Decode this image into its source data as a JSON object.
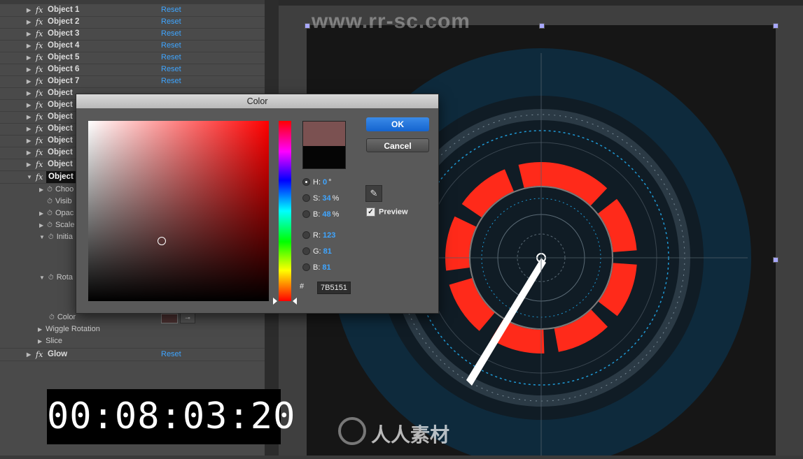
{
  "effects": {
    "reset_label": "Reset",
    "objects": [
      {
        "name": "Object 1"
      },
      {
        "name": "Object 2"
      },
      {
        "name": "Object 3"
      },
      {
        "name": "Object 4"
      },
      {
        "name": "Object 5"
      },
      {
        "name": "Object 6"
      },
      {
        "name": "Object 7"
      },
      {
        "name": "Object"
      },
      {
        "name": "Object"
      },
      {
        "name": "Object"
      },
      {
        "name": "Object"
      },
      {
        "name": "Object"
      },
      {
        "name": "Object"
      },
      {
        "name": "Object"
      },
      {
        "name": "Object"
      }
    ],
    "properties": [
      "Choo",
      "Visib",
      "Opac",
      "Scale",
      "Initia",
      "Rota"
    ],
    "color_label": "Color",
    "wiggle_label": "Wiggle Rotation",
    "slice_label": "Slice",
    "glow_label": "Glow"
  },
  "dialog": {
    "title": "Color",
    "ok": "OK",
    "cancel": "Cancel",
    "preview": "Preview",
    "preview_checked": true,
    "h_label": "H:",
    "h_value": "0",
    "h_unit": "°",
    "s_label": "S:",
    "s_value": "34",
    "s_unit": "%",
    "b_label": "B:",
    "b_value": "48",
    "b_unit": "%",
    "r_label": "R:",
    "r_value": "123",
    "g_label": "G:",
    "g_value": "81",
    "bl_label": "B:",
    "bl_value": "81",
    "hex_label": "#",
    "hex_value": "7B5151",
    "new_color": "#7b5151",
    "old_color": "#050505"
  },
  "timecode": "00:08:03:20",
  "watermark": "www.rr-sc.com",
  "logo_text": "人人素材",
  "viewer": {
    "accent": "#ff2a1a",
    "ring_color": "#0e2a3c"
  }
}
